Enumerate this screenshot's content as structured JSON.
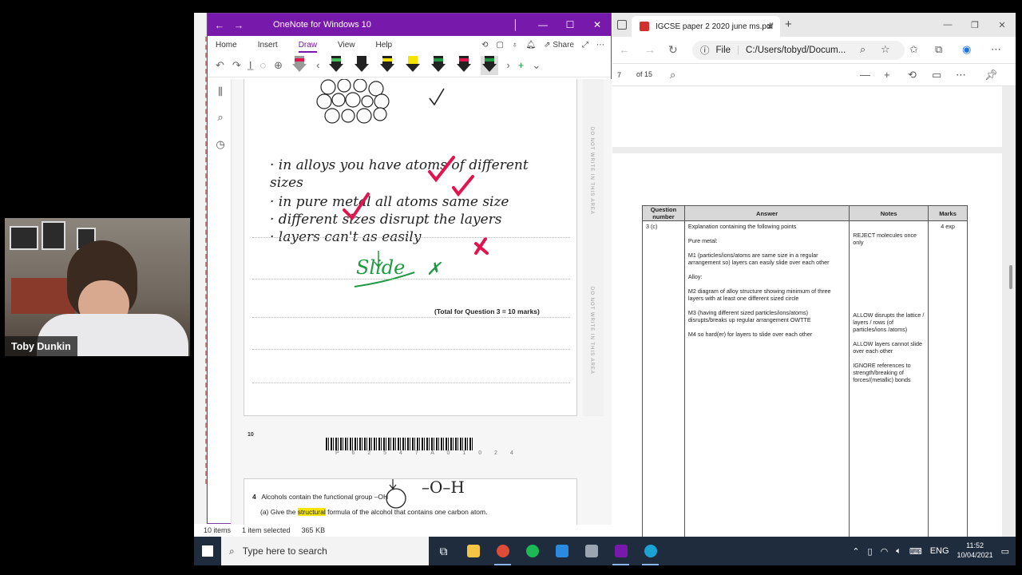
{
  "onenote": {
    "title": "OneNote for Windows 10",
    "menu": [
      "Home",
      "Insert",
      "Draw",
      "View",
      "Help"
    ],
    "active_menu": "Draw",
    "share_label": "Share",
    "handwriting": {
      "line1": "· in alloys you have atoms of different",
      "line2": "sizes",
      "line3": "· in pure metal all atoms same size",
      "line4": "· different sizes disrupt the layers",
      "line5": "· layers can't as easily",
      "slide": "Slide",
      "cross": "✗"
    },
    "total_label": "(Total for Question 3 = 10 marks)",
    "page_number": "10",
    "barcode_text": "P 6 2 5 4 7 A 0 1 0 2 4",
    "q4_number": "4",
    "q4_text": "Alcohols contain the functional group –OH",
    "q4a_label": "(a)",
    "q4a_pre": "Give the ",
    "q4a_highlight": "structural",
    "q4a_post": " formula of the alcohol that contains one carbon atom.",
    "oh_drawing": "–O–H",
    "margin_text": "DO NOT WRITE IN THIS AREA"
  },
  "explorer_status": {
    "items": "10 items",
    "selected": "1 item selected",
    "size": "365 KB"
  },
  "edge": {
    "tab_title": "IGCSE paper 2 2020 june ms.pdf",
    "url_scheme": "File",
    "url": "C:/Users/tobyd/Docum...",
    "page_current": "7",
    "page_total": "of 15"
  },
  "markscheme": {
    "headers": [
      "Question number",
      "Answer",
      "Notes",
      "Marks"
    ],
    "question": "3   (c)",
    "answer": [
      "Explanation containing the following points",
      "Pure metal:",
      "M1 (particles/ions/atoms are same size in a regular arrangement so) layers can easily slide over each other",
      "Alloy:",
      "M2 diagram of alloy structure showing minimum of three layers with at least one different sized circle",
      "M3 (having different sized particles/ions/atoms) disrupts/breaks up regular arrangement OWTTE",
      "M4 so hard(er) for layers to slide over each other"
    ],
    "notes": [
      "REJECT molecules once only",
      "ALLOW disrupts the lattice / layers / rows (of particles/ions /atoms)",
      "ALLOW layers cannot slide over each other",
      "IGNORE references to strength/breaking of forces/(metallic) bonds"
    ],
    "marks": "4 exp"
  },
  "webcam": {
    "name": "Toby Dunkin"
  },
  "taskbar": {
    "search_placeholder": "Type here to search",
    "language": "ENG",
    "time": "11:52",
    "date": "10/04/2021"
  },
  "colors": {
    "onenote_purple": "#7719aa",
    "taskbar": "#1f2c3d",
    "check_red": "#e2134d",
    "ink_green": "#1f9a43"
  }
}
